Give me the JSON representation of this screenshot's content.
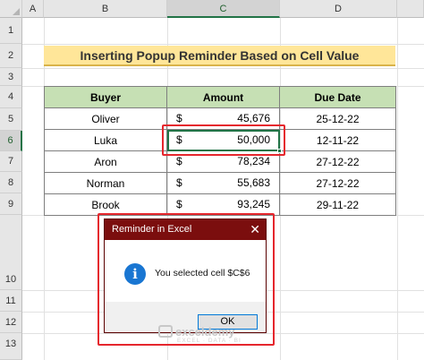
{
  "columns": [
    "A",
    "B",
    "C",
    "D"
  ],
  "rows": [
    "1",
    "2",
    "3",
    "4",
    "5",
    "6",
    "7",
    "8",
    "9",
    "10",
    "11",
    "12",
    "13"
  ],
  "title": "Inserting Popup Reminder Based on Cell Value",
  "table": {
    "headers": [
      "Buyer",
      "Amount",
      "Due Date"
    ],
    "currency": "$",
    "rows": [
      {
        "buyer": "Oliver",
        "amount": "45,676",
        "date": "25-12-22"
      },
      {
        "buyer": "Luka",
        "amount": "50,000",
        "date": "12-11-22"
      },
      {
        "buyer": "Aron",
        "amount": "78,234",
        "date": "27-12-22"
      },
      {
        "buyer": "Norman",
        "amount": "55,683",
        "date": "27-12-22"
      },
      {
        "buyer": "Brook",
        "amount": "93,245",
        "date": "29-11-22"
      }
    ]
  },
  "dialog": {
    "title": "Reminder in Excel",
    "close": "✕",
    "icon": "i",
    "message": "You selected cell $C$6",
    "ok_label": "OK"
  },
  "watermark": {
    "name": "exceldemy",
    "tagline": "EXCEL · DATA · BI"
  },
  "colors": {
    "title_fill": "#ffe699",
    "header_fill": "#c6e0b4",
    "highlight": "#e5262d",
    "dialog_title": "#7b0e0e"
  }
}
